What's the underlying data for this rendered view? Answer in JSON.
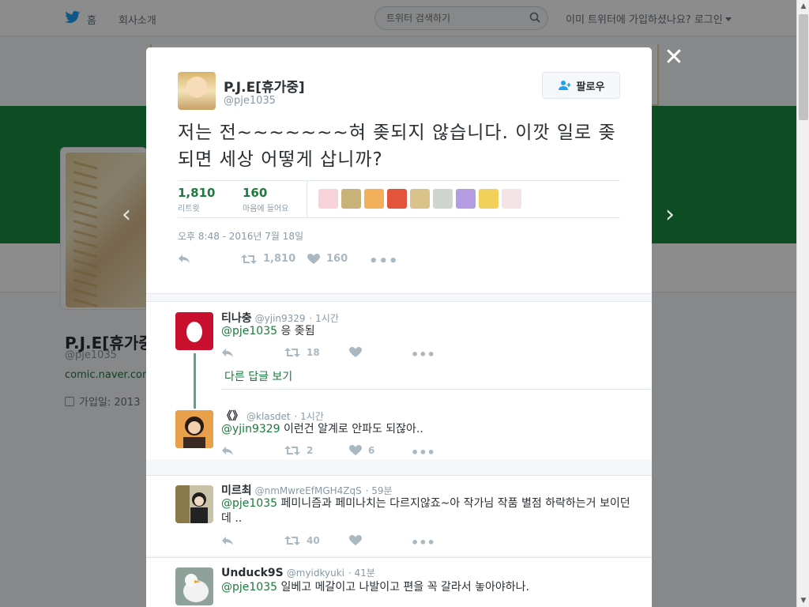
{
  "topbar": {
    "home": "홈",
    "about": "회사소개",
    "search_placeholder": "트위터 검색하기",
    "login": "이미 트위터에 가입하셨나요? 로그인"
  },
  "profile": {
    "name": "P.J.E[휴가중]",
    "handle": "@pje1035",
    "link": "comic.naver.com",
    "joined": "가입일: 2013"
  },
  "tweet": {
    "author_name": "P.J.E[휴가중]",
    "author_handle": "@pje1035",
    "follow_label": "팔로우",
    "text": "저는 전~~~~~~~혀 좆되지 않습니다. 이깟 일로 좆되면 세상 어떻게 삽니까?",
    "retweets": "1,810",
    "retweets_label": "리트윗",
    "likes": "160",
    "likes_label": "마음에 들어요",
    "timestamp": "오후 8:48 - 2016년 7월 18일",
    "action_retweets": "1,810",
    "action_likes": "160"
  },
  "likers": [
    {
      "name": "liker-avatar-1",
      "color": "#f7d2d9"
    },
    {
      "name": "liker-avatar-2",
      "color": "#c8b27a"
    },
    {
      "name": "liker-avatar-3",
      "color": "#f3b05a"
    },
    {
      "name": "liker-avatar-4",
      "color": "#e2553c"
    },
    {
      "name": "liker-avatar-5",
      "color": "#d9c38a"
    },
    {
      "name": "liker-avatar-6",
      "color": "#cfd6cf"
    },
    {
      "name": "liker-avatar-7",
      "color": "#b49ce2"
    },
    {
      "name": "liker-avatar-8",
      "color": "#f1d15a"
    },
    {
      "name": "liker-avatar-9",
      "color": "#f3e3e7"
    }
  ],
  "replies": [
    {
      "name": "티나충",
      "handle": "@yjin9329",
      "time": "· 1시간",
      "mention": "@pje1035",
      "text": " 응 좆됨",
      "retweets": "18",
      "likes": "",
      "avatar_color": "#c8102e"
    },
    {
      "name": "《》",
      "handle": "@klasdet",
      "time": "· 1시간",
      "mention": "@yjin9329",
      "text": " 이런건 알계로 안파도 되잖아..",
      "retweets": "2",
      "likes": "6",
      "avatar_color": "#6b3b2a"
    },
    {
      "name": "미르최",
      "handle": "@nmMwreEfMGH4ZqS",
      "time": "· 59분",
      "mention": "@pje1035",
      "text": " 페미니즘과 페미나치는 다르지않죠~아 작가님 작품 별점 하락하는거 보이던데 ..",
      "retweets": "40",
      "likes": "",
      "avatar_color": "#3a3a3a"
    },
    {
      "name": "Unduck9S",
      "handle": "@myidkyuki",
      "time": "· 41분",
      "mention": "@pje1035",
      "text": " 일베고 메갈이고 나발이고 편을 꼭 갈라서 놓아야하나.",
      "retweets": "",
      "likes": "",
      "avatar_color": "#cfcfcf"
    }
  ],
  "thread": {
    "more_replies": "다른 답글 보기"
  },
  "colors": {
    "accent": "#1b7a3d",
    "cover": "#1a8a43",
    "twitter_blue": "#1da1f2"
  }
}
